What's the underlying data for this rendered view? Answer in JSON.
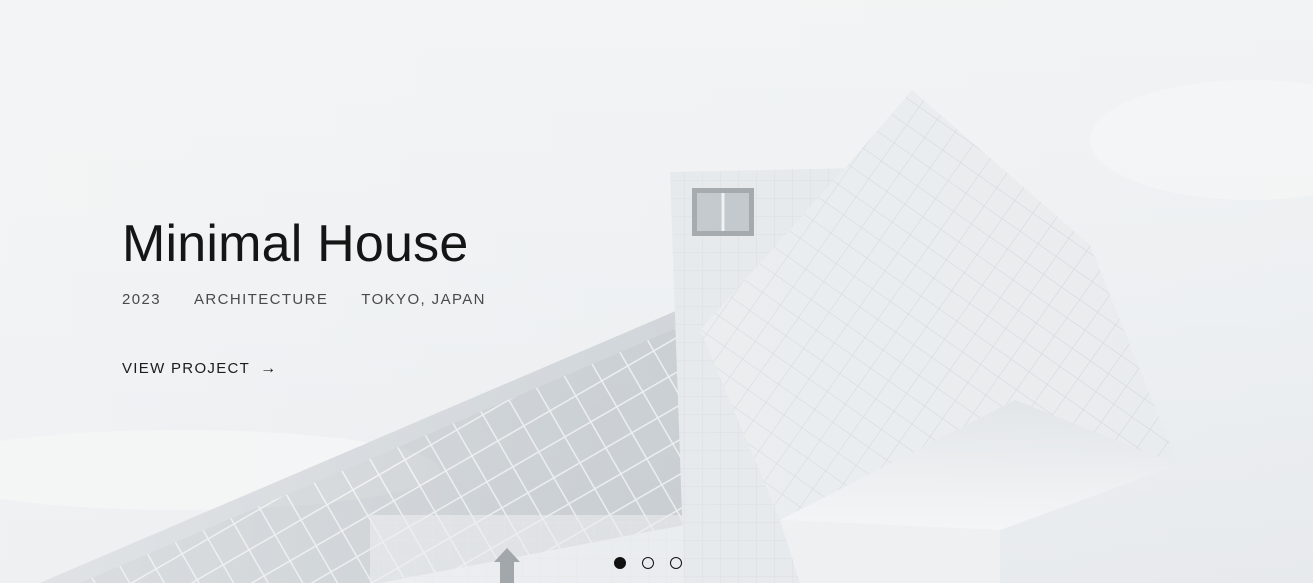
{
  "slide": {
    "title": "Minimal House",
    "meta": {
      "year": "2023",
      "category": "ARCHITECTURE",
      "location": "TOKYO, JAPAN"
    },
    "cta": {
      "label": "VIEW PROJECT",
      "arrow": "→"
    },
    "background_image": "white geometric architecture building against pale sky"
  },
  "carousel": {
    "total": 3,
    "active_index": 0
  },
  "colors": {
    "title": "#151515",
    "meta": "#4a4a4a",
    "dot": "#111111",
    "building": "#e4e8eb",
    "sky": "#eef0f2"
  }
}
